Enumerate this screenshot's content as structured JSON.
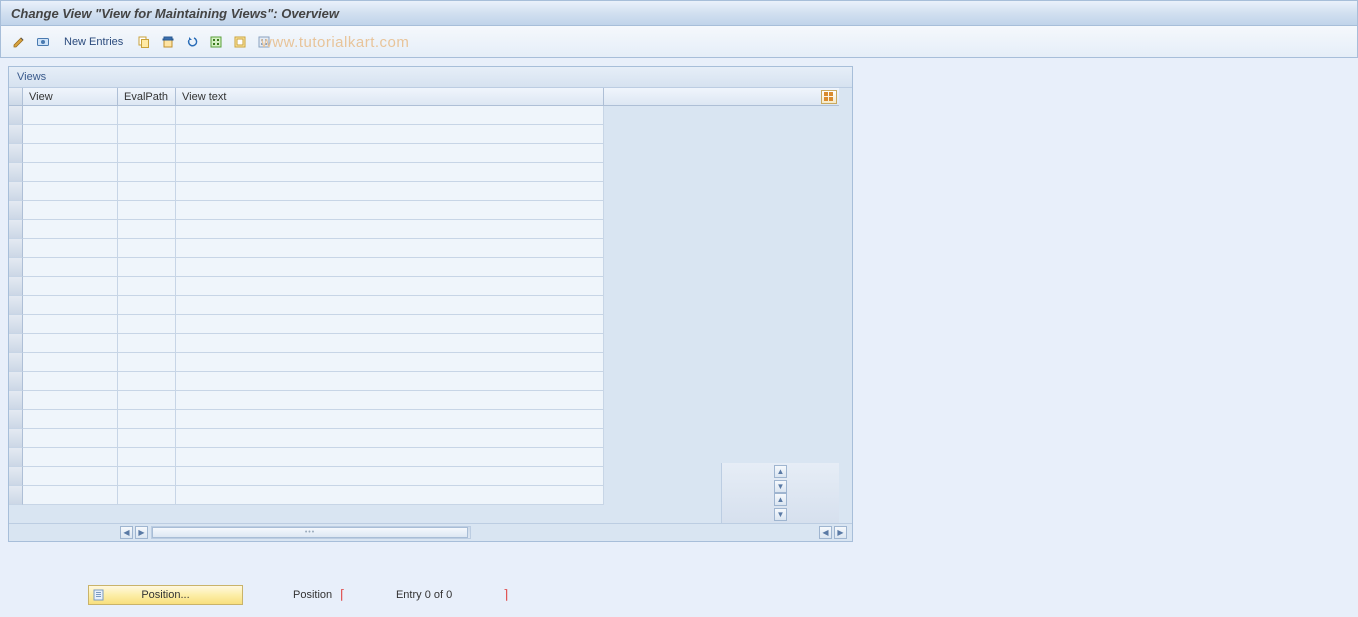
{
  "title": "Change View \"View for Maintaining Views\": Overview",
  "toolbar": {
    "new_entries": "New Entries"
  },
  "watermark": "www.tutorialkart.com",
  "panel": {
    "heading": "Views",
    "columns": {
      "view": "View",
      "evalpath": "EvalPath",
      "viewtext": "View text"
    }
  },
  "footer": {
    "position_button": "Position...",
    "position_label": "Position",
    "entry_info": "Entry 0 of 0"
  }
}
